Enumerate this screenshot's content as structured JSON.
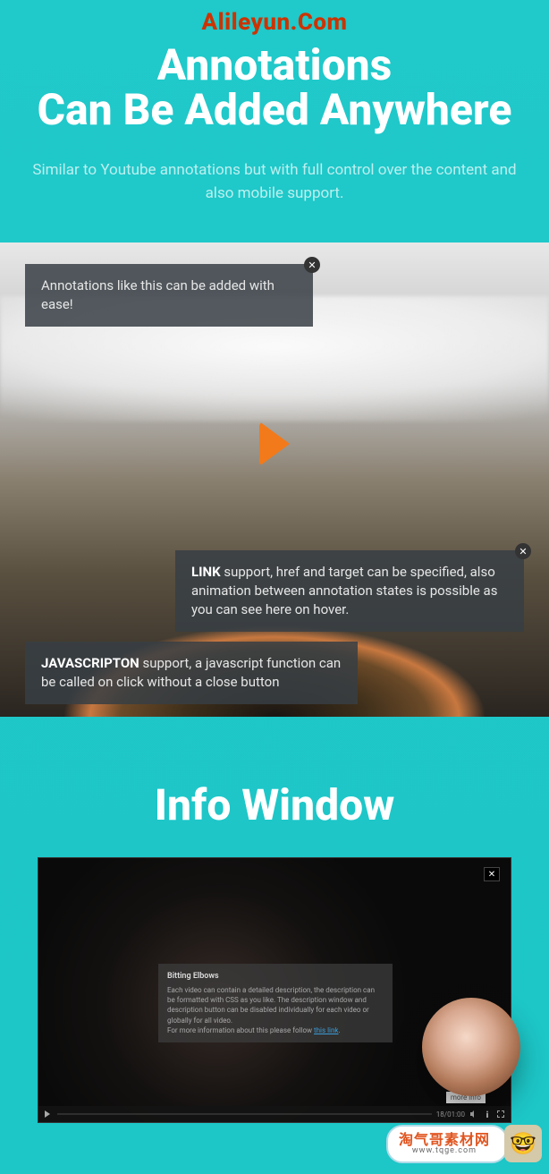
{
  "logo": "Alileyun.Com",
  "headline": {
    "line1": "Annotations",
    "line2": "Can Be Added Anywhere"
  },
  "subtext": "Similar to Youtube annotations but with full control over the content and also mobile support.",
  "annotations": {
    "a1": "Annotations like this can be added with ease!",
    "a2_bold": "LINK",
    "a2_rest": " support, href and target can be specified, also animation between annotation states is possible as you can see here on hover.",
    "a3_bold": "JAVASCRIPTON",
    "a3_rest": " support, a javascript function can be called on click without a close button"
  },
  "info_title": "Info Window",
  "info_panel": {
    "title": "Bitting Elbows",
    "body1": "Each video can contain a detailed description, the description can be formatted with CSS as you like. The description window and description button can be disabled individually for each video or globally for all video.",
    "body2_pre": "For more information about this please follow ",
    "body2_link": "this link"
  },
  "video_controls": {
    "time": "18/01:00",
    "more_info": "more info"
  },
  "close_glyph": "✕",
  "footer": {
    "line1": "淘气哥素材网",
    "line2": "www.tqge.com",
    "avatar": "🤓"
  }
}
